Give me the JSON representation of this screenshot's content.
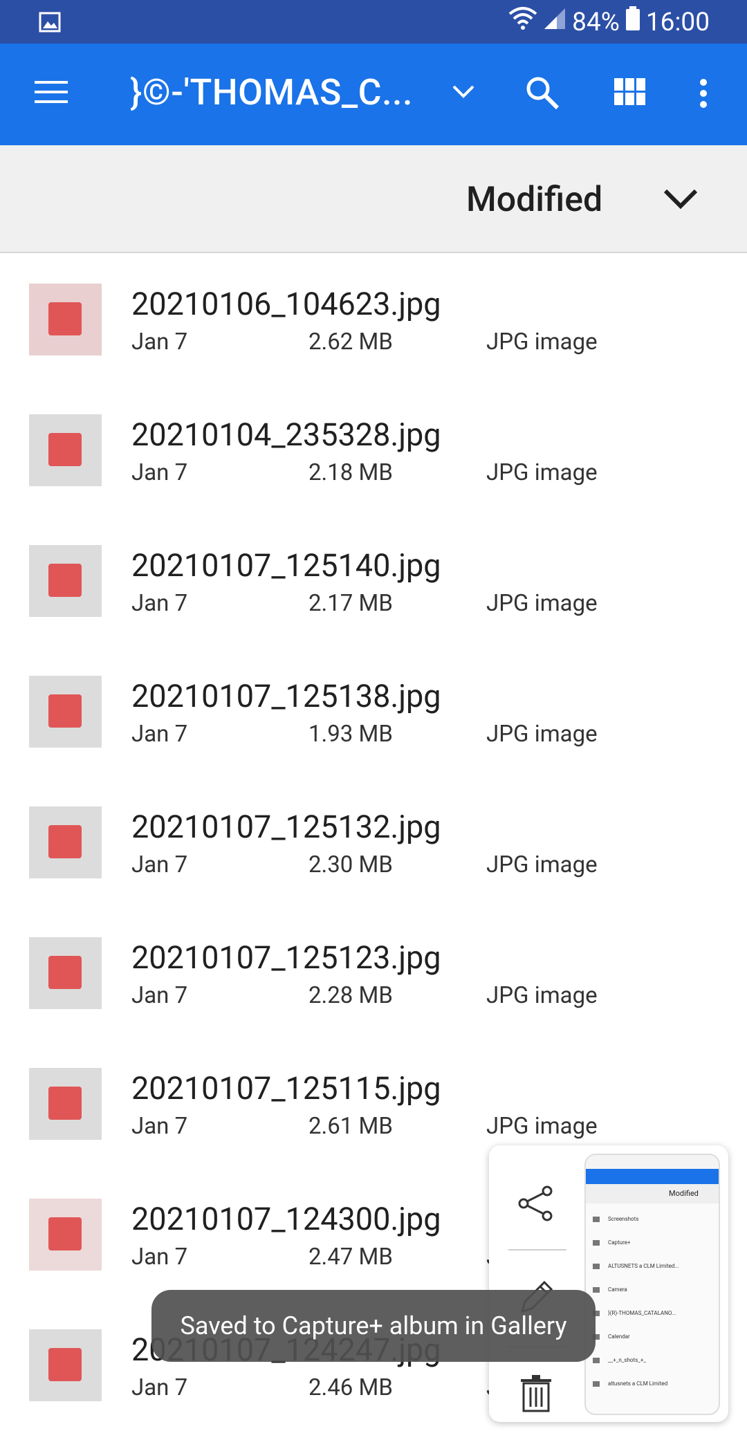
{
  "status_bar": {
    "battery": "84%",
    "time": "16:00"
  },
  "app_bar": {
    "title": "}©-'THOMAS_C..."
  },
  "sort_bar": {
    "label": "Modified"
  },
  "files": [
    {
      "name": "20210106_104623.jpg",
      "date": "Jan 7",
      "size": "2.62 MB",
      "type": "JPG image"
    },
    {
      "name": "20210104_235328.jpg",
      "date": "Jan 7",
      "size": "2.18 MB",
      "type": "JPG image"
    },
    {
      "name": "20210107_125140.jpg",
      "date": "Jan 7",
      "size": "2.17 MB",
      "type": "JPG image"
    },
    {
      "name": "20210107_125138.jpg",
      "date": "Jan 7",
      "size": "1.93 MB",
      "type": "JPG image"
    },
    {
      "name": "20210107_125132.jpg",
      "date": "Jan 7",
      "size": "2.30 MB",
      "type": "JPG image"
    },
    {
      "name": "20210107_125123.jpg",
      "date": "Jan 7",
      "size": "2.28 MB",
      "type": "JPG image"
    },
    {
      "name": "20210107_125115.jpg",
      "date": "Jan 7",
      "size": "2.61 MB",
      "type": "JPG image"
    },
    {
      "name": "20210107_124300.jpg",
      "date": "Jan 7",
      "size": "2.47 MB",
      "type": "JPG image"
    },
    {
      "name": "20210107_124247.jpg",
      "date": "Jan 7",
      "size": "2.46 MB",
      "type": "JPG image"
    }
  ],
  "capture_panel": {
    "preview": {
      "modified": "Modified",
      "items": [
        "Screenshots",
        "Capture+",
        "ALTUSNETS a CLM Limited...",
        "Camera",
        "}(R)-THOMAS_CATALANO...",
        "Calendar",
        "__+_n_shots_+_",
        "altusnets a CLM Limited"
      ]
    }
  },
  "toast": {
    "message": "Saved to Capture+ album in Gallery"
  }
}
